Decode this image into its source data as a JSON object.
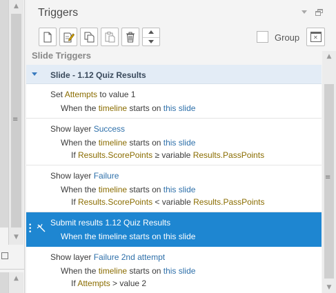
{
  "panel": {
    "title": "Triggers",
    "group_label": "Group",
    "group_checked": false
  },
  "toolbar": {
    "buttons": [
      "new-trigger",
      "edit-trigger",
      "copy-trigger",
      "paste-trigger",
      "delete-trigger",
      "move-up",
      "move-down",
      "group-window"
    ]
  },
  "list": {
    "section_header": "Slide Triggers",
    "slide_header": "Slide - 1.12 Quiz Results",
    "triggers": [
      {
        "action": [
          "Set ",
          "Attempts",
          " to value 1"
        ],
        "condition": [
          "When the ",
          "timeline",
          " starts",
          " on ",
          "this slide"
        ],
        "selected": false
      },
      {
        "action": [
          "Show layer ",
          "Success"
        ],
        "condition": [
          "When the ",
          "timeline",
          " starts",
          " on ",
          "this slide"
        ],
        "if": [
          "If ",
          "Results.ScorePoints",
          " ≥ variable ",
          "Results.PassPoints"
        ],
        "selected": false
      },
      {
        "action": [
          "Show layer ",
          "Failure"
        ],
        "condition": [
          "When the ",
          "timeline",
          " starts",
          " on ",
          "this slide"
        ],
        "if": [
          "If ",
          "Results.ScorePoints",
          " < variable ",
          "Results.PassPoints"
        ],
        "selected": false
      },
      {
        "action": [
          "Submit results ",
          "1.12 Quiz Results"
        ],
        "condition": [
          "When the ",
          "timeline",
          " starts",
          " on ",
          "this slide"
        ],
        "selected": true
      },
      {
        "action": [
          "Show layer ",
          "Failure 2nd attempt"
        ],
        "condition": [
          "When the ",
          "timeline",
          " starts",
          " on ",
          "this slide"
        ],
        "if": [
          "If ",
          "Attempts",
          " > value 2"
        ],
        "selected": false
      }
    ]
  },
  "colors": {
    "accent_blue": "#2d6fa9",
    "keyword_olive": "#8a6c00",
    "selection": "#1e86d1",
    "slide_header_bg": "#e3ecf6"
  }
}
